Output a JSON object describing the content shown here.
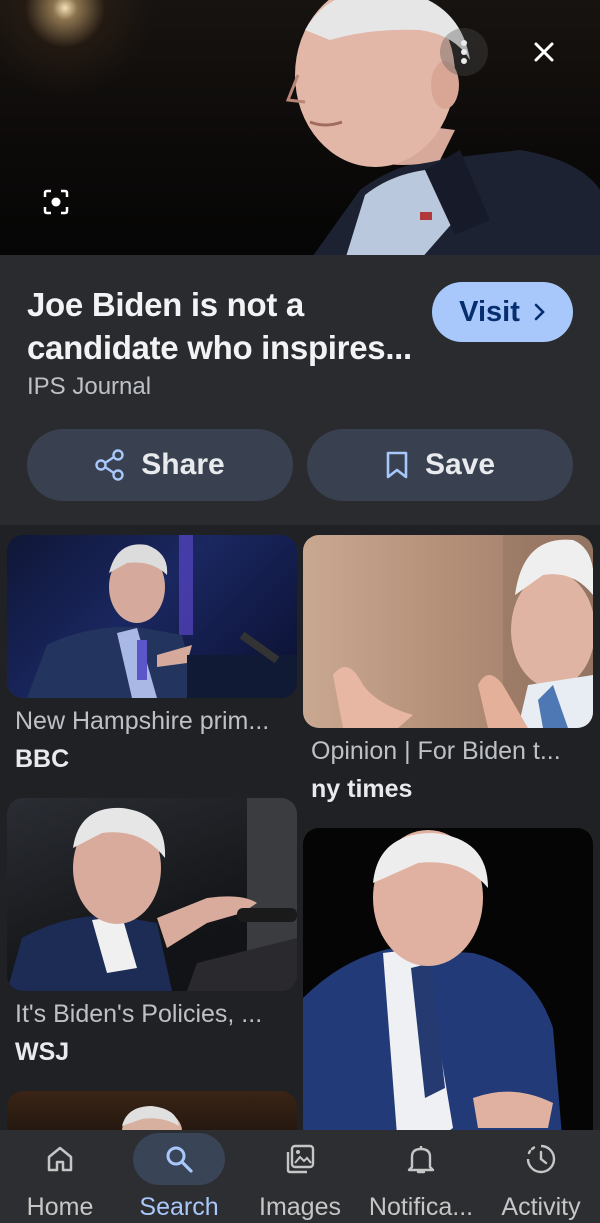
{
  "hero": {
    "more_icon": "more-vert-icon",
    "close_icon": "close-icon",
    "lens_icon": "lens-search-icon"
  },
  "result": {
    "title": "Joe Biden is not a candidate who inspires...",
    "source": "IPS Journal",
    "visit_label": "Visit",
    "share_label": "Share",
    "save_label": "Save"
  },
  "related": [
    {
      "title": "New Hampshire prim...",
      "source": "BBC"
    },
    {
      "title": "Opinion | For Biden t...",
      "source": "ny times"
    },
    {
      "title": "It's Biden's Policies, ...",
      "source": "WSJ"
    },
    {
      "title": "",
      "source": ""
    }
  ],
  "nav": {
    "items": [
      {
        "label": "Home",
        "icon": "home-icon",
        "active": false
      },
      {
        "label": "Search",
        "icon": "search-icon",
        "active": true
      },
      {
        "label": "Images",
        "icon": "images-icon",
        "active": false
      },
      {
        "label": "Notifica...",
        "icon": "bell-icon",
        "active": false
      },
      {
        "label": "Activity",
        "icon": "activity-icon",
        "active": false
      }
    ]
  },
  "colors": {
    "background": "#202124",
    "panel": "#2a2b2f",
    "accent": "#a8c7fa",
    "button": "#394150"
  }
}
